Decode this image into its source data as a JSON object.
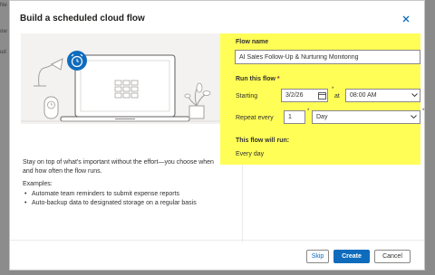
{
  "background": {
    "fragments": [
      "Ne",
      "ow",
      "ud"
    ]
  },
  "dialog": {
    "title": "Build a scheduled cloud flow",
    "description": "Stay on top of what's important without the effort—you choose when and how often the flow runs.",
    "examples_title": "Examples:",
    "examples": [
      "Automate team reminders to submit expense reports",
      "Auto-backup data to designated storage on a regular basis"
    ]
  },
  "form": {
    "flow_name_label": "Flow name",
    "flow_name_value": "AI Sales Follow-Up & Nurturing Monitoring",
    "run_label": "Run this flow",
    "required_mark": "*",
    "starting_label": "Starting",
    "date_value": "3/2/26",
    "at_label": "at",
    "time_value": "08:00 AM",
    "repeat_label": "Repeat every",
    "repeat_interval": "1",
    "repeat_unit": "Day",
    "will_run_label": "This flow will run:",
    "will_run_value": "Every day"
  },
  "footer": {
    "skip_label": "Skip",
    "create_label": "Create",
    "cancel_label": "Cancel"
  },
  "colors": {
    "primary": "#0f6cbd",
    "highlight": "#fffe57",
    "required": "#a4262c"
  }
}
